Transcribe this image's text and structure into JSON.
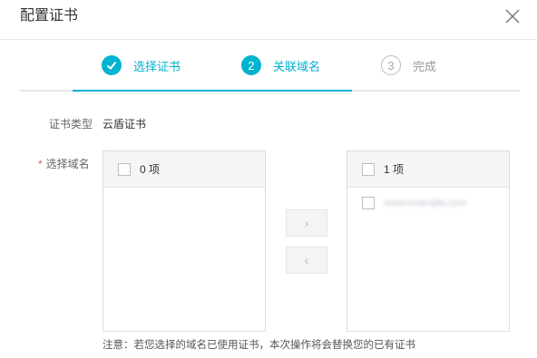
{
  "dialog": {
    "title": "配置证书",
    "close_icon": "close-icon"
  },
  "steps": [
    {
      "number": "✓",
      "label": "选择证书",
      "state": "done"
    },
    {
      "number": "2",
      "label": "关联域名",
      "state": "active"
    },
    {
      "number": "3",
      "label": "完成",
      "state": "todo"
    }
  ],
  "form": {
    "cert_type_label": "证书类型",
    "cert_type_value": "云盾证书",
    "required_mark": "*",
    "domain_label": "选择域名"
  },
  "transfer": {
    "left_count": "0 项",
    "right_count": "1 项",
    "right_items": [
      "www.example.com"
    ],
    "move_right_icon": "chevron-right-icon",
    "move_left_icon": "chevron-left-icon",
    "move_right_glyph": "›",
    "move_left_glyph": "‹"
  },
  "note": "注意：若您选择的域名已使用证书，本次操作将会替换您的已有证书",
  "colors": {
    "accent": "#00b3d0",
    "required": "#ee5555"
  }
}
